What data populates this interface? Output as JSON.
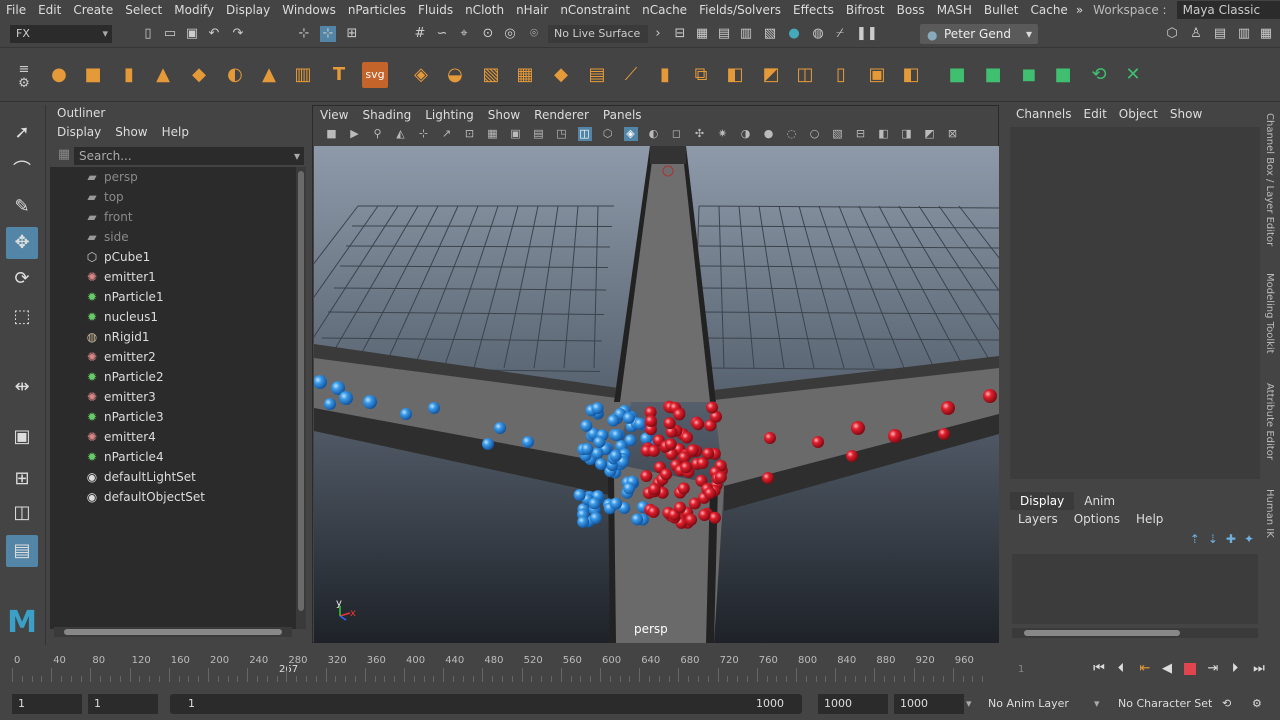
{
  "menubar": {
    "items": [
      "File",
      "Edit",
      "Create",
      "Select",
      "Modify",
      "Display",
      "Windows",
      "nParticles",
      "Fluids",
      "nCloth",
      "nHair",
      "nConstraint",
      "nCache",
      "Fields/Solvers",
      "Effects",
      "Bifrost",
      "Boss",
      "MASH",
      "Bullet",
      "Cache"
    ],
    "workspace_label": "Workspace :",
    "workspace_value": "Maya Classic"
  },
  "statusline": {
    "menuset": "FX",
    "live_surface": "No Live Surface",
    "user": "Peter Gend"
  },
  "shelf": {
    "icons": [
      "sphere-icon",
      "cube-icon",
      "cylinder-icon",
      "cone-icon",
      "plane-icon",
      "torus-icon",
      "pyramid-icon",
      "pipe-icon",
      "text-icon",
      "svg-icon",
      "polygon-tool-icon",
      "nparticle-icon",
      "emitter-icon",
      "grid-icon",
      "cube-icon",
      "combine-icon",
      "curve-icon",
      "extrude-icon",
      "layers-icon",
      "box-icon",
      "bevel-icon",
      "bridge-icon",
      "split-icon",
      "uv-icon",
      "target-icon",
      "nucleus-icon",
      "nrigid-icon",
      "ncloth-icon",
      "field-icon",
      "cache-icon",
      "connect-icon"
    ],
    "svg_label": "svg"
  },
  "toolbox": {
    "tools": [
      "select-tool-icon",
      "lasso-tool-icon",
      "paint-select-icon",
      "move-tool-icon",
      "rotate-tool-icon",
      "scale-tool-icon",
      "soft-mod-icon",
      "single-view-icon",
      "layout-icon",
      "outliner-layout-icon"
    ]
  },
  "outliner": {
    "title": "Outliner",
    "menu": [
      "Display",
      "Show",
      "Help"
    ],
    "search_placeholder": "Search...",
    "items": [
      {
        "label": "persp",
        "icon": "camera-icon",
        "dim": true
      },
      {
        "label": "top",
        "icon": "camera-icon",
        "dim": true
      },
      {
        "label": "front",
        "icon": "camera-icon",
        "dim": true
      },
      {
        "label": "side",
        "icon": "camera-icon",
        "dim": true
      },
      {
        "label": "pCube1",
        "icon": "mesh-icon",
        "dim": false
      },
      {
        "label": "emitter1",
        "icon": "emitter-icon",
        "dim": false
      },
      {
        "label": "nParticle1",
        "icon": "nparticle-icon",
        "dim": false
      },
      {
        "label": "nucleus1",
        "icon": "nucleus-icon",
        "dim": false
      },
      {
        "label": "nRigid1",
        "icon": "nrigid-icon",
        "dim": false
      },
      {
        "label": "emitter2",
        "icon": "emitter-icon",
        "dim": false
      },
      {
        "label": "nParticle2",
        "icon": "nparticle-icon",
        "dim": false
      },
      {
        "label": "emitter3",
        "icon": "emitter-icon",
        "dim": false
      },
      {
        "label": "nParticle3",
        "icon": "nparticle-icon",
        "dim": false
      },
      {
        "label": "emitter4",
        "icon": "emitter-icon",
        "dim": false
      },
      {
        "label": "nParticle4",
        "icon": "nparticle-icon",
        "dim": false
      },
      {
        "label": "defaultLightSet",
        "icon": "set-icon",
        "dim": false
      },
      {
        "label": "defaultObjectSet",
        "icon": "set-icon",
        "dim": false
      }
    ]
  },
  "viewport": {
    "menu": [
      "View",
      "Shading",
      "Lighting",
      "Show",
      "Renderer",
      "Panels"
    ],
    "camera_label": "persp",
    "axis_y": "y",
    "axis_x": "x",
    "colors": {
      "blue_particle": "#2f8fe0",
      "red_particle": "#e0202e",
      "bg_top": "#8f9aa8",
      "bg_bottom": "#1f2329"
    }
  },
  "channelbox": {
    "menu": [
      "Channels",
      "Edit",
      "Object",
      "Show"
    ]
  },
  "layereditor": {
    "tabs": [
      "Display",
      "Anim"
    ],
    "menu": [
      "Layers",
      "Options",
      "Help"
    ]
  },
  "sidetabs": [
    "Channel Box / Layer Editor",
    "Modeling Toolkit",
    "Attribute Editor",
    "Human IK"
  ],
  "timeslider": {
    "ticks": [
      "0",
      "40",
      "80",
      "120",
      "160",
      "200",
      "240",
      "280",
      "320",
      "360",
      "400",
      "440",
      "480",
      "520",
      "560",
      "600",
      "640",
      "680",
      "720",
      "760",
      "800",
      "840",
      "880",
      "920",
      "960"
    ],
    "current_frame": "267",
    "frame_field": "1"
  },
  "rangebar": {
    "start": "1",
    "anim_start": "1",
    "slider_start": "1",
    "slider_end": "1000",
    "anim_end": "1000",
    "end": "1000",
    "anim_layer": "No Anim Layer",
    "char_set": "No Character Set"
  }
}
